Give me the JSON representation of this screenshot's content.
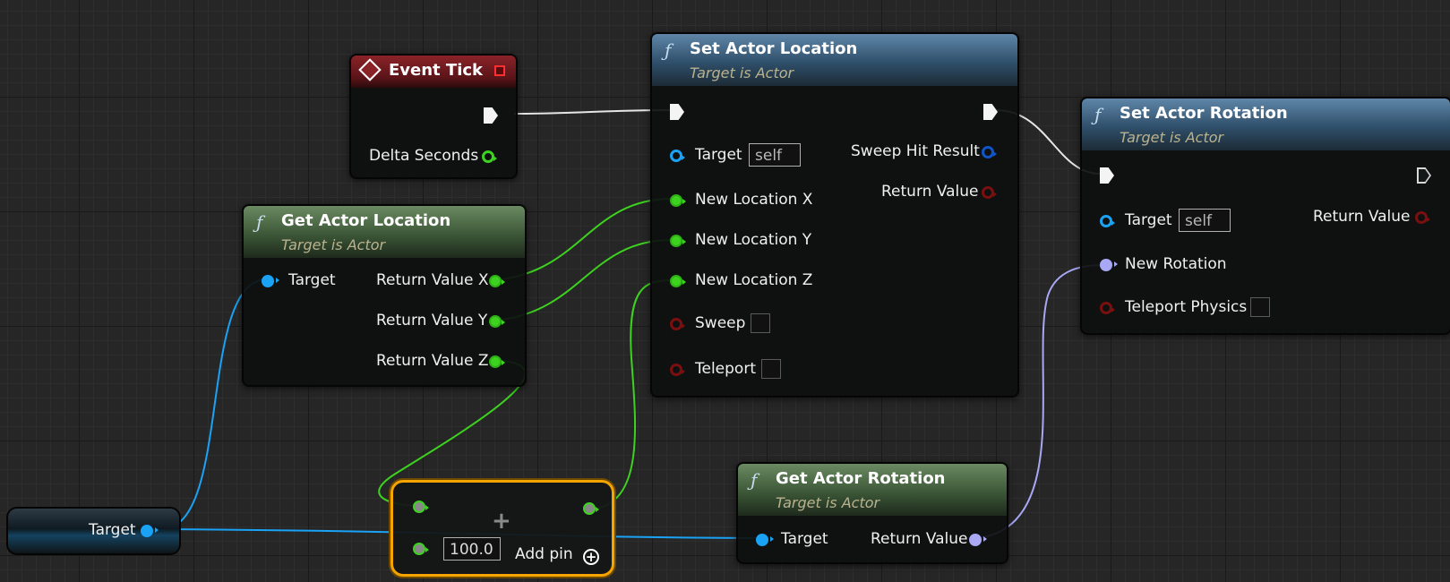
{
  "event_tick": {
    "title": "Event Tick",
    "delta": "Delta Seconds"
  },
  "set_actor_location": {
    "title": "Set Actor Location",
    "subtitle": "Target is Actor",
    "target": "Target",
    "target_value": "self",
    "new_x": "New Location X",
    "new_y": "New Location Y",
    "new_z": "New Location Z",
    "sweep": "Sweep",
    "teleport": "Teleport",
    "sweep_hit": "Sweep Hit Result",
    "return_value": "Return Value"
  },
  "set_actor_rotation": {
    "title": "Set Actor Rotation",
    "subtitle": "Target is Actor",
    "target": "Target",
    "target_value": "self",
    "new_rotation": "New Rotation",
    "teleport_physics": "Teleport Physics",
    "return_value": "Return Value"
  },
  "get_actor_location": {
    "title": "Get Actor Location",
    "subtitle": "Target is Actor",
    "target": "Target",
    "rx": "Return Value X",
    "ry": "Return Value Y",
    "rz": "Return Value Z"
  },
  "get_actor_rotation": {
    "title": "Get Actor Rotation",
    "subtitle": "Target is Actor",
    "target": "Target",
    "return_value": "Return Value"
  },
  "reroute": {
    "label": "Target"
  },
  "add_node": {
    "value": "100.0",
    "add_pin": "Add pin"
  },
  "colors": {
    "exec": "#f4f4f4",
    "float": "#3dd21f",
    "object": "#1aa2f5",
    "rotator": "#a8a8f5",
    "selection": "#f5a400"
  }
}
